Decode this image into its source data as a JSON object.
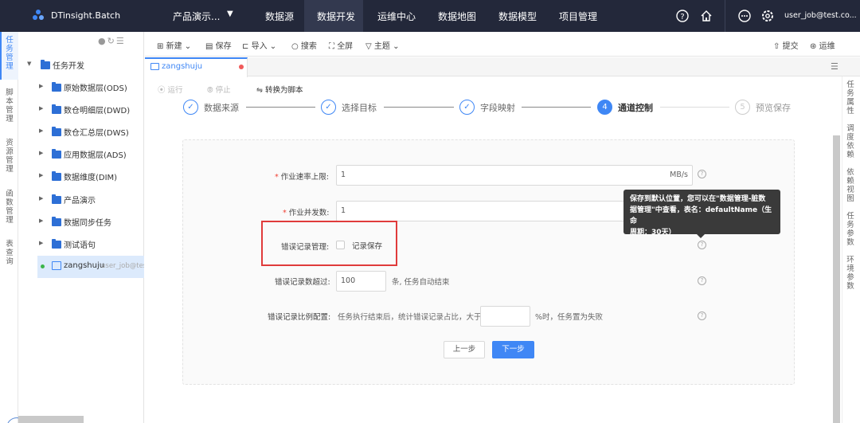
{
  "topbar": {
    "brand": "DTinsight.Batch",
    "project": "产品演示...",
    "nav": [
      "数据源",
      "数据开发",
      "运维中心",
      "数据地图",
      "数据模型",
      "项目管理"
    ],
    "active_nav": "数据开发",
    "user": "user_job@test.co..."
  },
  "left_rail": [
    "任务管理",
    "脚本管理",
    "资源管理",
    "函数管理",
    "表查询"
  ],
  "tree": {
    "root": "任务开发",
    "folders": [
      "原始数据层(ODS)",
      "数仓明细层(DWD)",
      "数仓汇总层(DWS)",
      "应用数据层(ADS)",
      "数据维度(DIM)",
      "产品演示",
      "数据同步任务",
      "测试语句"
    ],
    "selected_file": "zangshuju",
    "selected_owner": "user_job@tes"
  },
  "toolbar": {
    "new": "新建",
    "save": "保存",
    "import": "导入",
    "search": "搜索",
    "fullscreen": "全屏",
    "theme": "主题",
    "submit": "提交",
    "ops": "运维"
  },
  "tab": {
    "label": "zangshuju"
  },
  "subbar": {
    "run": "运行",
    "stop": "停止",
    "to_script": "转换为脚本"
  },
  "right_rail": [
    "任务属性",
    "调度依赖",
    "依赖视图",
    "任务参数",
    "环境参数"
  ],
  "steps": [
    {
      "label": "数据来源",
      "mark": "✓"
    },
    {
      "label": "选择目标",
      "mark": "✓"
    },
    {
      "label": "字段映射",
      "mark": "✓"
    },
    {
      "label": "通道控制",
      "mark": "4"
    },
    {
      "label": "预览保存",
      "mark": "5"
    }
  ],
  "form": {
    "rate_label": "作业速率上限:",
    "rate_value": "1",
    "rate_unit": "MB/s",
    "concurrency_label": "作业并发数:",
    "concurrency_value": "1",
    "error_mgmt_label": "错误记录管理:",
    "error_save_label": "记录保存",
    "error_count_label": "错误记录数超过:",
    "error_count_value": "100",
    "error_count_suffix": "条, 任务自动结束",
    "error_ratio_label": "错误记录比例配置:",
    "error_ratio_prefix": "任务执行结束后，统计错误记录占比，大于",
    "error_ratio_suffix": "%时，任务置为失败",
    "prev": "上一步",
    "next": "下一步"
  },
  "tooltip": {
    "line1": "保存到默认位置，您可以在\"数据管理-脏数",
    "line2": "据管理\"中查看，表名：defaultName（生命",
    "line3": "周期：30天）"
  },
  "colors": {
    "topbar": "#23283a",
    "accent": "#3f87f5",
    "highlight_box": "#e03b3b"
  }
}
